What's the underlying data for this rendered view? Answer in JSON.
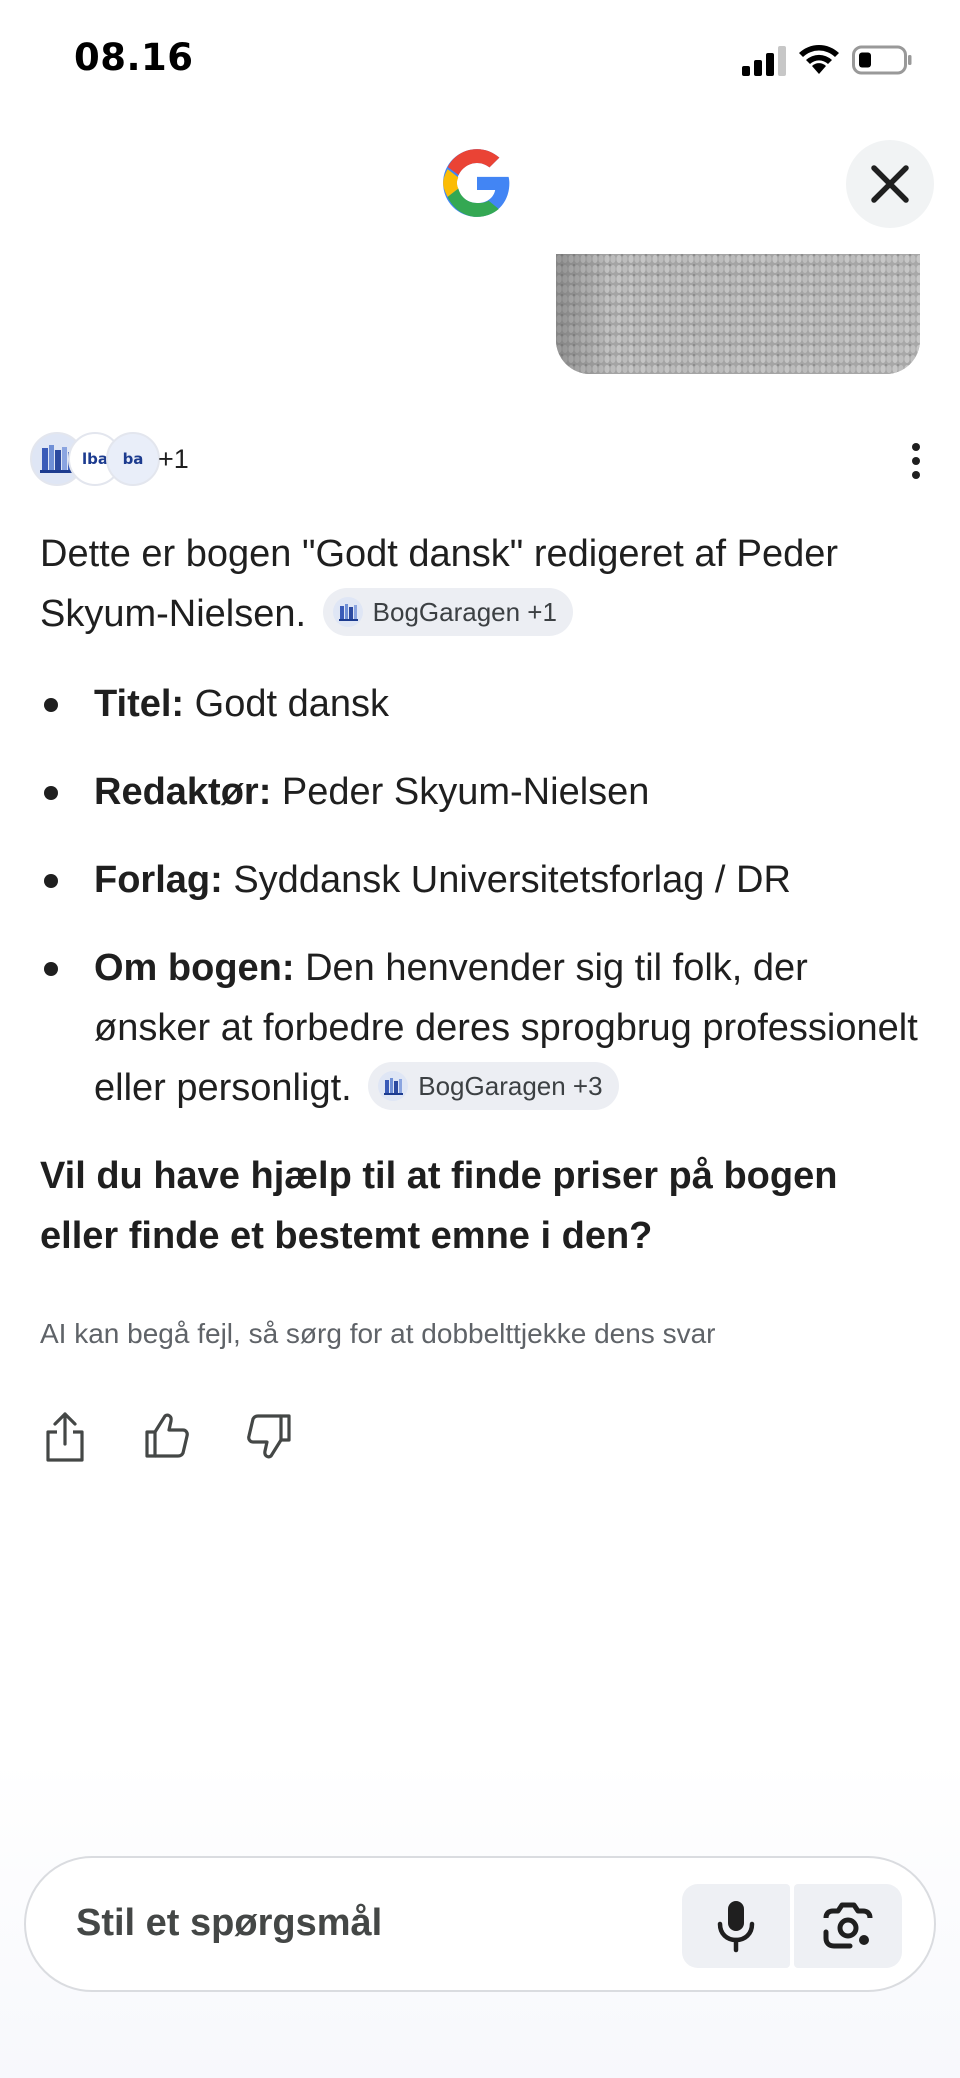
{
  "status_bar": {
    "time": "08.16",
    "signal_icon": "cellular-signal-icon",
    "wifi_icon": "wifi-icon",
    "battery_icon": "battery-low-icon"
  },
  "header": {
    "logo_icon": "google-g-logo",
    "close_icon": "close-icon"
  },
  "sources": {
    "favicons": [
      "bookshelf-favicon",
      "lba",
      "ba"
    ],
    "more_count": "+1",
    "menu_icon": "more-vert-icon"
  },
  "answer": {
    "intro": "Dette er bogen \"Godt dansk\" redigeret af Peder Skyum-Nielsen.",
    "intro_chip": "BogGaragen +1",
    "facts": [
      {
        "label": "Titel:",
        "value": " Godt dansk"
      },
      {
        "label": "Redaktør:",
        "value": " Peder Skyum-Nielsen"
      },
      {
        "label": "Forlag:",
        "value": " Syddansk Universitetsforlag / DR"
      },
      {
        "label": "Om bogen:",
        "value": " Den henvender sig til folk, der ønsker at forbedre deres sprogbrug professionelt eller personligt.",
        "chip": "BogGaragen +3"
      }
    ],
    "question": "Vil du have hjælp til at finde priser på bogen eller finde et bestemt emne i den?",
    "disclaimer": "AI kan begå fejl, så sørg for at dobbelttjekke dens svar"
  },
  "actions": {
    "share_icon": "share-icon",
    "thumbs_up_icon": "thumbs-up-icon",
    "thumbs_down_icon": "thumbs-down-icon"
  },
  "ask_bar": {
    "placeholder": "Stil et spørgsmål",
    "mic_icon": "microphone-icon",
    "lens_icon": "google-lens-icon"
  },
  "colors": {
    "text": "#1f1f1f",
    "chip_bg": "#eceef3",
    "muted": "#5f6368",
    "button_bg": "#eef0f4"
  }
}
